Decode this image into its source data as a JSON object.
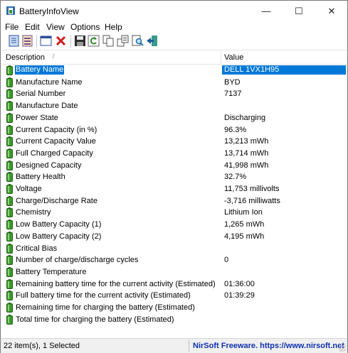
{
  "window": {
    "title": "BatteryInfoView",
    "minimize": "—",
    "maximize": "☐",
    "close": "✕"
  },
  "menu": [
    "File",
    "Edit",
    "View",
    "Options",
    "Help"
  ],
  "toolbar": {
    "icons": [
      "html-report-icon",
      "properties-icon",
      "window-icon",
      "delete-icon",
      "save-icon",
      "refresh-icon",
      "copy-icon",
      "copy-all-icon",
      "find-icon",
      "exit-icon"
    ]
  },
  "columns": {
    "description": "Description",
    "value": "Value",
    "sort_arrow": "/"
  },
  "rows": [
    {
      "description": "Battery Name",
      "value": "DELL 1VX1H95",
      "selected": true
    },
    {
      "description": "Manufacture Name",
      "value": "BYD"
    },
    {
      "description": "Serial Number",
      "value": "7137"
    },
    {
      "description": "Manufacture Date",
      "value": ""
    },
    {
      "description": "Power State",
      "value": "Discharging"
    },
    {
      "description": "Current Capacity (in %)",
      "value": "96.3%"
    },
    {
      "description": "Current Capacity Value",
      "value": "13,213 mWh"
    },
    {
      "description": "Full Charged Capacity",
      "value": "13,714 mWh"
    },
    {
      "description": "Designed Capacity",
      "value": "41,998 mWh"
    },
    {
      "description": "Battery Health",
      "value": "32.7%"
    },
    {
      "description": "Voltage",
      "value": "11,753 millivolts"
    },
    {
      "description": "Charge/Discharge Rate",
      "value": "-3,716 milliwatts"
    },
    {
      "description": "Chemistry",
      "value": "Lithium Ion"
    },
    {
      "description": "Low Battery Capacity (1)",
      "value": "1,265 mWh"
    },
    {
      "description": "Low Battery Capacity (2)",
      "value": "4,195 mWh"
    },
    {
      "description": "Critical Bias",
      "value": ""
    },
    {
      "description": "Number of charge/discharge cycles",
      "value": "0"
    },
    {
      "description": "Battery Temperature",
      "value": ""
    },
    {
      "description": "Remaining battery time for the current activity (Estimated)",
      "value": "01:36:00"
    },
    {
      "description": "Full battery time for the current activity (Estimated)",
      "value": "01:39:29"
    },
    {
      "description": "Remaining time for charging the battery (Estimated)",
      "value": ""
    },
    {
      "description": "Total  time for charging the battery (Estimated)",
      "value": ""
    }
  ],
  "status": {
    "items": "22 item(s), 1 Selected",
    "credit": "NirSoft Freeware. https://www.nirsoft.net"
  },
  "colors": {
    "selection": "#0078d7",
    "battery_green": "#3a9a2a",
    "credit_text": "#1030b0"
  }
}
